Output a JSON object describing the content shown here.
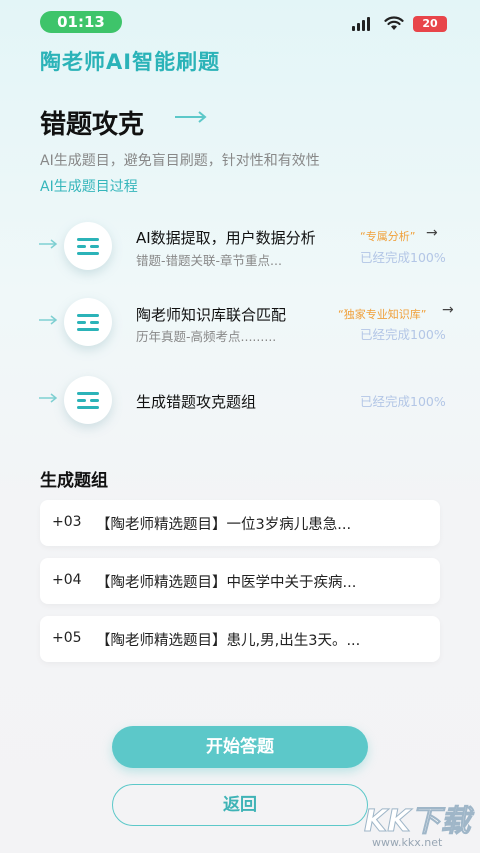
{
  "status_bar": {
    "time": "01:13",
    "battery": "20"
  },
  "app_title": "陶老师AI智能刷题",
  "section": {
    "title": "错题攻克",
    "subtitle": "AI生成题目，避免盲目刷题，针对性和有效性",
    "process_link": "AI生成题目过程"
  },
  "steps": [
    {
      "title": "AI数据提取，用户数据分析",
      "sub": "错题-错题关联-章节重点...",
      "tag": "“专属分析”",
      "tag_arrow": "→",
      "status": "已经完成100%"
    },
    {
      "title": "陶老师知识库联合匹配",
      "sub": "历年真题-高频考点.........",
      "tag": "“独家专业知识库”",
      "tag_arrow": "→",
      "status": "已经完成100%"
    },
    {
      "title": "生成错题攻克题组",
      "sub": "",
      "tag": "",
      "tag_arrow": "",
      "status": "已经完成100%"
    }
  ],
  "generated": {
    "title": "生成题组",
    "items": [
      {
        "num": "+03",
        "text": "【陶老师精选题目】一位3岁病儿患急..."
      },
      {
        "num": "+04",
        "text": "【陶老师精选题目】中医学中关于疾病..."
      },
      {
        "num": "+05",
        "text": "【陶老师精选题目】患儿,男,出生3天。..."
      }
    ]
  },
  "buttons": {
    "start": "开始答题",
    "back": "返回"
  },
  "watermark": {
    "logo": "KK下载",
    "url": "www.kkx.net"
  },
  "colors": {
    "accent": "#2bb3b8",
    "button": "#5cc8c9",
    "tag": "#f0a03a",
    "status": "#b3c6e6",
    "time_pill": "#3ec46a",
    "battery": "#e8454a"
  }
}
